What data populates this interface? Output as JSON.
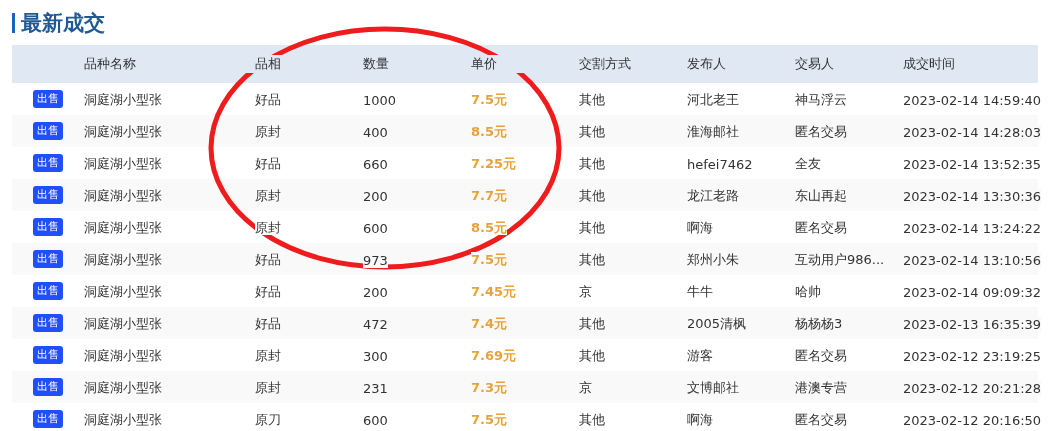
{
  "section_title": "最新成交",
  "table": {
    "columns": [
      "品种名称",
      "品相",
      "数量",
      "单价",
      "交割方式",
      "发布人",
      "交易人",
      "成交时间"
    ],
    "rows": [
      {
        "tag": "出售",
        "name": "洞庭湖小型张",
        "grade": "好品",
        "quantity": "1000",
        "price": "7.5元",
        "delivery": "其他",
        "publisher": "河北老王",
        "trader": "神马浮云",
        "time": "2023-02-14 14:59:40"
      },
      {
        "tag": "出售",
        "name": "洞庭湖小型张",
        "grade": "原封",
        "quantity": "400",
        "price": "8.5元",
        "delivery": "其他",
        "publisher": "淮海邮社",
        "trader": "匿名交易",
        "time": "2023-02-14 14:28:03"
      },
      {
        "tag": "出售",
        "name": "洞庭湖小型张",
        "grade": "好品",
        "quantity": "660",
        "price": "7.25元",
        "delivery": "其他",
        "publisher": "hefei7462",
        "trader": "全友",
        "time": "2023-02-14 13:52:35"
      },
      {
        "tag": "出售",
        "name": "洞庭湖小型张",
        "grade": "原封",
        "quantity": "200",
        "price": "7.7元",
        "delivery": "其他",
        "publisher": "龙江老路",
        "trader": "东山再起",
        "time": "2023-02-14 13:30:36"
      },
      {
        "tag": "出售",
        "name": "洞庭湖小型张",
        "grade": "原封",
        "quantity": "600",
        "price": "8.5元",
        "delivery": "其他",
        "publisher": "啊海",
        "trader": "匿名交易",
        "time": "2023-02-14 13:24:22"
      },
      {
        "tag": "出售",
        "name": "洞庭湖小型张",
        "grade": "好品",
        "quantity": "973",
        "price": "7.5元",
        "delivery": "其他",
        "publisher": "郑州小朱",
        "trader": "互动用户986...",
        "time": "2023-02-14 13:10:56"
      },
      {
        "tag": "出售",
        "name": "洞庭湖小型张",
        "grade": "好品",
        "quantity": "200",
        "price": "7.45元",
        "delivery": "京",
        "publisher": "牛牛",
        "trader": "哈帅",
        "time": "2023-02-14 09:09:32"
      },
      {
        "tag": "出售",
        "name": "洞庭湖小型张",
        "grade": "好品",
        "quantity": "472",
        "price": "7.4元",
        "delivery": "其他",
        "publisher": "2005清枫",
        "trader": "杨杨杨3",
        "time": "2023-02-13 16:35:39"
      },
      {
        "tag": "出售",
        "name": "洞庭湖小型张",
        "grade": "原封",
        "quantity": "300",
        "price": "7.69元",
        "delivery": "其他",
        "publisher": "游客",
        "trader": "匿名交易",
        "time": "2023-02-12 23:19:25"
      },
      {
        "tag": "出售",
        "name": "洞庭湖小型张",
        "grade": "原封",
        "quantity": "231",
        "price": "7.3元",
        "delivery": "京",
        "publisher": "文博邮社",
        "trader": "港澳专营",
        "time": "2023-02-12 20:21:28"
      },
      {
        "tag": "出售",
        "name": "洞庭湖小型张",
        "grade": "原刀",
        "quantity": "600",
        "price": "7.5元",
        "delivery": "其他",
        "publisher": "啊海",
        "trader": "匿名交易",
        "time": "2023-02-12 20:16:50"
      }
    ]
  },
  "annotation": {
    "kind": "ellipse"
  }
}
